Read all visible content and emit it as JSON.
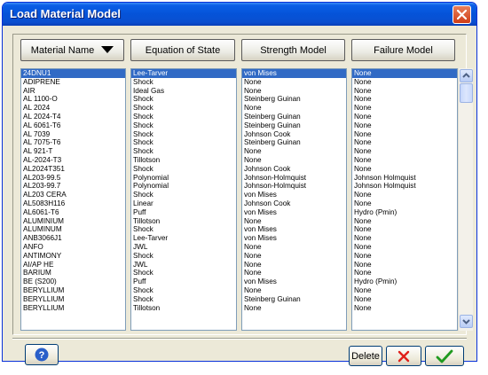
{
  "window": {
    "title": "Load Material Model"
  },
  "headers": {
    "material_name": "Material Name",
    "equation_of_state": "Equation of State",
    "strength_model": "Strength Model",
    "failure_model": "Failure Model"
  },
  "materials": [
    {
      "name": "24DNU1",
      "eos": "Lee-Tarver",
      "strength": "von Mises",
      "failure": "None"
    },
    {
      "name": "ADIPRENE",
      "eos": "Shock",
      "strength": "None",
      "failure": "None"
    },
    {
      "name": "AIR",
      "eos": "Ideal Gas",
      "strength": "None",
      "failure": "None"
    },
    {
      "name": "AL 1100-O",
      "eos": "Shock",
      "strength": "Steinberg Guinan",
      "failure": "None"
    },
    {
      "name": "AL 2024",
      "eos": "Shock",
      "strength": "None",
      "failure": "None"
    },
    {
      "name": "AL 2024-T4",
      "eos": "Shock",
      "strength": "Steinberg Guinan",
      "failure": "None"
    },
    {
      "name": "AL 6061-T6",
      "eos": "Shock",
      "strength": "Steinberg Guinan",
      "failure": "None"
    },
    {
      "name": "AL 7039",
      "eos": "Shock",
      "strength": "Johnson Cook",
      "failure": "None"
    },
    {
      "name": "AL 7075-T6",
      "eos": "Shock",
      "strength": "Steinberg Guinan",
      "failure": "None"
    },
    {
      "name": "AL 921-T",
      "eos": "Shock",
      "strength": "None",
      "failure": "None"
    },
    {
      "name": "AL-2024-T3",
      "eos": "Tillotson",
      "strength": "None",
      "failure": "None"
    },
    {
      "name": "AL2024T351",
      "eos": "Shock",
      "strength": "Johnson Cook",
      "failure": "None"
    },
    {
      "name": "AL203-99.5",
      "eos": "Polynomial",
      "strength": "Johnson-Holmquist",
      "failure": "Johnson Holmquist"
    },
    {
      "name": "AL203-99.7",
      "eos": "Polynomial",
      "strength": "Johnson-Holmquist",
      "failure": "Johnson Holmquist"
    },
    {
      "name": "AL203 CERA",
      "eos": "Shock",
      "strength": "von Mises",
      "failure": "None"
    },
    {
      "name": "AL5083H116",
      "eos": "Linear",
      "strength": "Johnson Cook",
      "failure": "None"
    },
    {
      "name": "AL6061-T6",
      "eos": "Puff",
      "strength": "von Mises",
      "failure": "Hydro (Pmin)"
    },
    {
      "name": "ALUMINIUM",
      "eos": "Tillotson",
      "strength": "None",
      "failure": "None"
    },
    {
      "name": "ALUMINUM",
      "eos": "Shock",
      "strength": "von Mises",
      "failure": "None"
    },
    {
      "name": "ANB3066J1",
      "eos": "Lee-Tarver",
      "strength": "von Mises",
      "failure": "None"
    },
    {
      "name": "ANFO",
      "eos": "JWL",
      "strength": "None",
      "failure": "None"
    },
    {
      "name": "ANTIMONY",
      "eos": "Shock",
      "strength": "None",
      "failure": "None"
    },
    {
      "name": "AI/AP HE",
      "eos": "JWL",
      "strength": "None",
      "failure": "None"
    },
    {
      "name": "BARIUM",
      "eos": "Shock",
      "strength": "None",
      "failure": "None"
    },
    {
      "name": "BE (S200)",
      "eos": "Puff",
      "strength": "von Mises",
      "failure": "Hydro (Pmin)"
    },
    {
      "name": "BERYLLIUM",
      "eos": "Shock",
      "strength": "None",
      "failure": "None"
    },
    {
      "name": "BERYLLIUM",
      "eos": "Shock",
      "strength": "Steinberg Guinan",
      "failure": "None"
    },
    {
      "name": "BERYLLIUM",
      "eos": "Tillotson",
      "strength": "None",
      "failure": "None"
    }
  ],
  "buttons": {
    "delete": "Delete"
  },
  "icons": {
    "help": "help-icon",
    "cancel": "cancel-x-icon",
    "ok": "ok-checkmark-icon",
    "close": "close-icon",
    "sort": "sort-down-arrow-icon"
  },
  "colors": {
    "selection": "#316ac5",
    "titlebar": "#0553d8",
    "cancel_red": "#e0201a",
    "ok_green": "#1f9a1f"
  }
}
